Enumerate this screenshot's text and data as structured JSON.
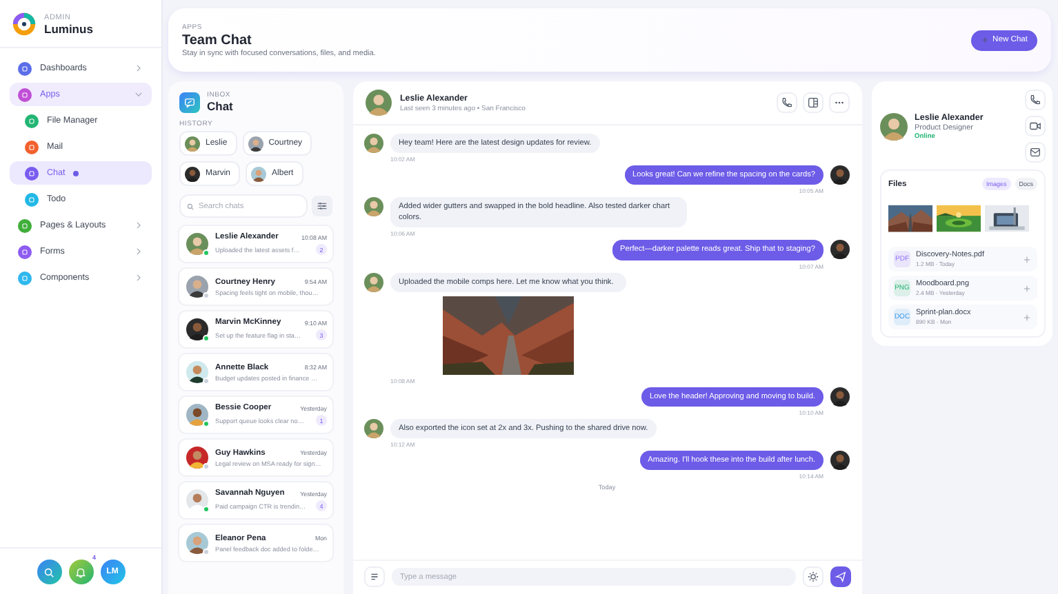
{
  "sidebar": {
    "brand": {
      "overline": "ADMIN",
      "name": "Luminus"
    },
    "items": [
      {
        "label": "Dashboards",
        "color": "#5b6ee8",
        "selected": false,
        "expanded": false
      },
      {
        "label": "Apps",
        "color": "#c04fd6",
        "selected": true,
        "expanded": true,
        "children": [
          {
            "label": "File Manager",
            "color": "#22b573",
            "selected": false
          },
          {
            "label": "Mail",
            "color": "#f2612e",
            "selected": false
          },
          {
            "label": "Chat",
            "color": "#7a5cf0",
            "selected": true
          },
          {
            "label": "Todo",
            "color": "#22b8e6",
            "selected": false
          }
        ]
      },
      {
        "label": "Pages & Layouts",
        "color": "#3fae3a",
        "selected": false,
        "expanded": false
      },
      {
        "label": "Forms",
        "color": "#8e5cf0",
        "selected": false,
        "expanded": false
      },
      {
        "label": "Components",
        "color": "#2fb8ee",
        "selected": false,
        "expanded": false
      }
    ],
    "dock": [
      {
        "kind": "search"
      },
      {
        "kind": "bell",
        "badge": "4"
      },
      {
        "kind": "initials",
        "label": "LM"
      }
    ]
  },
  "header": {
    "overline": "APPS",
    "title": "Team Chat",
    "subtitle": "Stay in sync with focused conversations, files, and media.",
    "button": "New Chat"
  },
  "inbox": {
    "overline": "INBOX",
    "title": "Chat",
    "history_label": "HISTORY",
    "history": [
      "Leslie",
      "Courtney",
      "Marvin",
      "Albert"
    ],
    "search_placeholder": "Search chats",
    "chats": [
      {
        "name": "Leslie Alexander",
        "time": "10:08 AM",
        "preview": "Uploaded the latest assets f…",
        "unread": "2",
        "online": true
      },
      {
        "name": "Courtney Henry",
        "time": "9:54 AM",
        "preview": "Spacing feels tight on mobile, thou…",
        "online": false
      },
      {
        "name": "Marvin McKinney",
        "time": "9:10 AM",
        "preview": "Set up the feature flag in sta…",
        "unread": "3",
        "online": true
      },
      {
        "name": "Annette Black",
        "time": "8:32 AM",
        "preview": "Budget updates posted in finance …",
        "online": false
      },
      {
        "name": "Bessie Cooper",
        "time": "Yesterday",
        "preview": "Support queue looks clear no…",
        "unread": "1",
        "online": true
      },
      {
        "name": "Guy Hawkins",
        "time": "Yesterday",
        "preview": "Legal review on MSA ready for sign…",
        "online": false
      },
      {
        "name": "Savannah Nguyen",
        "time": "Yesterday",
        "preview": "Paid campaign CTR is trendin…",
        "unread": "4",
        "online": true
      },
      {
        "name": "Eleanor Pena",
        "time": "Mon",
        "preview": "Panel feedback doc added to folde…",
        "online": false
      }
    ]
  },
  "conversation": {
    "name": "Leslie Alexander",
    "status": "Last seen 3 minutes ago • San Francisco",
    "messages": [
      {
        "kind": "them",
        "text": "Hey team! Here are the latest design updates for review.",
        "time": "10:02 AM"
      },
      {
        "kind": "me",
        "text": "Looks great! Can we refine the spacing on the cards?",
        "time": "10:05 AM"
      },
      {
        "kind": "them",
        "text": "Added wider gutters and swapped in the bold headline. Also tested darker chart colors.",
        "time": "10:06 AM"
      },
      {
        "kind": "me",
        "text": "Perfect—darker palette reads great. Ship that to staging?",
        "time": "10:07 AM"
      },
      {
        "kind": "them",
        "text": "Uploaded the mobile comps here. Let me know what you think.",
        "time": "10:08 AM"
      },
      {
        "kind": "me",
        "text": "Love the header! Approving and moving to build.",
        "time": "10:10 AM"
      },
      {
        "kind": "them",
        "text": "Also exported the icon set at 2x and 3x. Pushing to the shared drive now.",
        "time": "10:12 AM"
      },
      {
        "kind": "me",
        "text": "Amazing. I'll hook these into the build after lunch.",
        "time": "10:14 AM"
      }
    ],
    "divider": "Today",
    "composer_placeholder": "Type a message"
  },
  "profile": {
    "name": "Leslie Alexander",
    "role": "Product Designer",
    "status": "Online",
    "files": {
      "title": "Files",
      "tabs": [
        {
          "label": "Images",
          "selected": true
        },
        {
          "label": "Docs",
          "selected": false
        }
      ],
      "items": [
        {
          "type": "PDF",
          "name": "Discovery-Notes.pdf",
          "meta": "1.2 MB · Today",
          "color": "#8b6cf6"
        },
        {
          "type": "PNG",
          "name": "Moodboard.png",
          "meta": "2.4 MB · Yesterday",
          "color": "#22b573"
        },
        {
          "type": "DOC",
          "name": "Sprint-plan.docx",
          "meta": "890 KB · Mon",
          "color": "#3b9be8"
        }
      ]
    }
  }
}
